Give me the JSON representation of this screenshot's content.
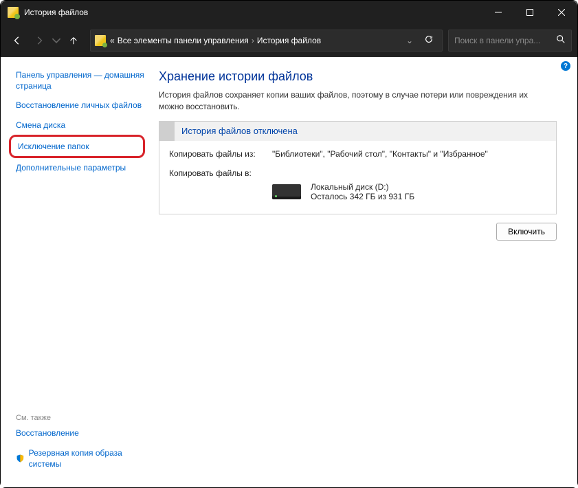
{
  "window": {
    "title": "История файлов"
  },
  "breadcrumb": {
    "prefix": "«",
    "part1": "Все элементы панели управления",
    "part2": "История файлов"
  },
  "search": {
    "placeholder": "Поиск в панели упра..."
  },
  "sidebar": {
    "home": "Панель управления — домашняя страница",
    "restore": "Восстановление личных файлов",
    "change_drive": "Смена диска",
    "exclude_folders": "Исключение папок",
    "advanced": "Дополнительные параметры",
    "see_also": "См. также",
    "recovery": "Восстановление",
    "image_backup": "Резервная копия образа системы"
  },
  "main": {
    "heading": "Хранение истории файлов",
    "desc": "История файлов сохраняет копии ваших файлов, поэтому в случае потери или повреждения их можно восстановить.",
    "status_title": "История файлов отключена",
    "copy_from_label": "Копировать файлы из:",
    "copy_from_value": "\"Библиотеки\", \"Рабочий стол\", \"Контакты\" и \"Избранное\"",
    "copy_to_label": "Копировать файлы в:",
    "drive_name": "Локальный диск (D:)",
    "drive_space": "Осталось 342 ГБ из 931 ГБ",
    "enable_button": "Включить"
  }
}
